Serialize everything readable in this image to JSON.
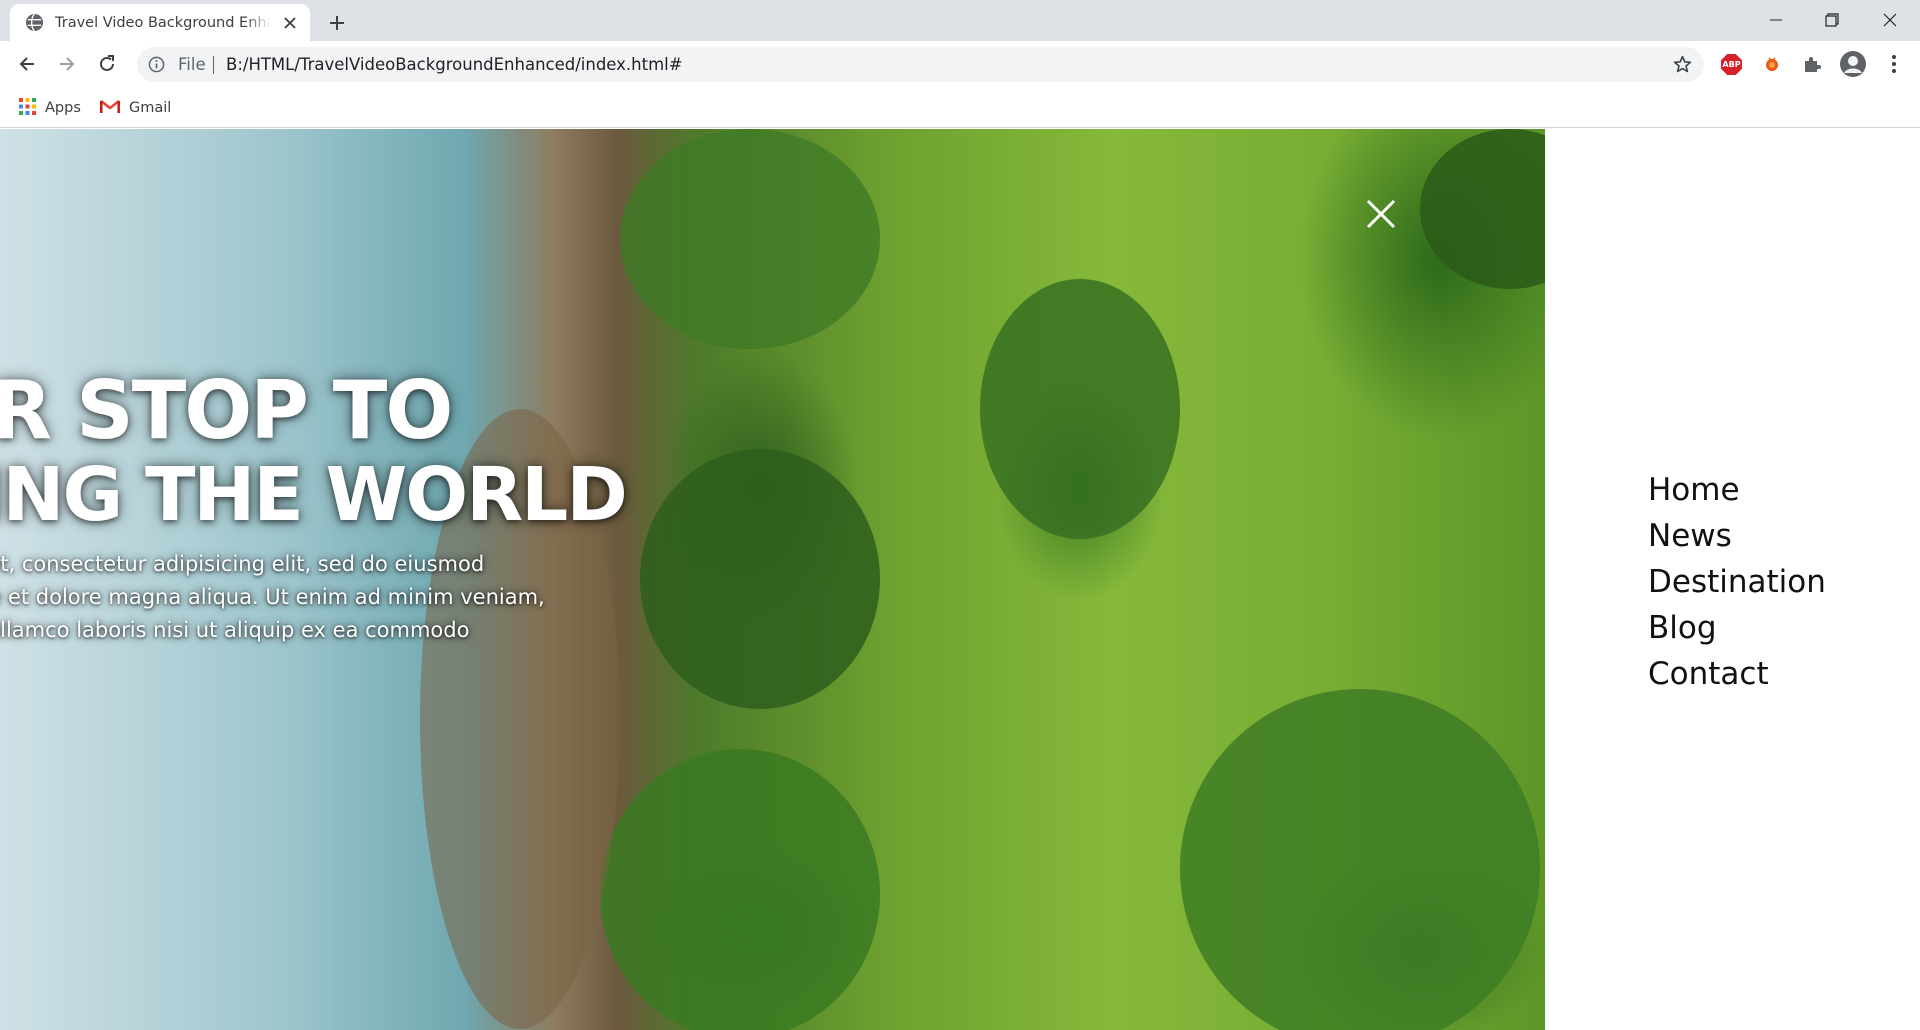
{
  "browser": {
    "tab_title": "Travel Video Background Enhanced",
    "omnibox": {
      "scheme_label": "File",
      "url": "B:/HTML/TravelVideoBackgroundEnhanced/index.html#"
    },
    "bookmarks": [
      {
        "label": "Apps",
        "icon": "apps-grid-icon"
      },
      {
        "label": "Gmail",
        "icon": "gmail-icon"
      }
    ],
    "extensions": [
      "adblock-plus-icon",
      "extension-bug-icon",
      "puzzle-icon",
      "profile-icon",
      "kebab-menu-icon"
    ]
  },
  "hero": {
    "line1": "ER STOP TO",
    "line2": "RING THE WORLD",
    "desc1": "amet, consectetur adipisicing elit, sed do eiusmod",
    "desc2": "bore et dolore magna aliqua. Ut enim ad minim veniam,",
    "desc3": "on ullamco laboris nisi ut aliquip ex ea commodo"
  },
  "menu": {
    "items": [
      {
        "label": "Home"
      },
      {
        "label": "News"
      },
      {
        "label": "Destination"
      },
      {
        "label": "Blog"
      },
      {
        "label": "Contact"
      }
    ]
  },
  "colors": {
    "tabstrip": "#dee1e6",
    "omnibox": "#f1f3f4",
    "menu_text": "#111111",
    "hero_text": "#ffffff"
  }
}
